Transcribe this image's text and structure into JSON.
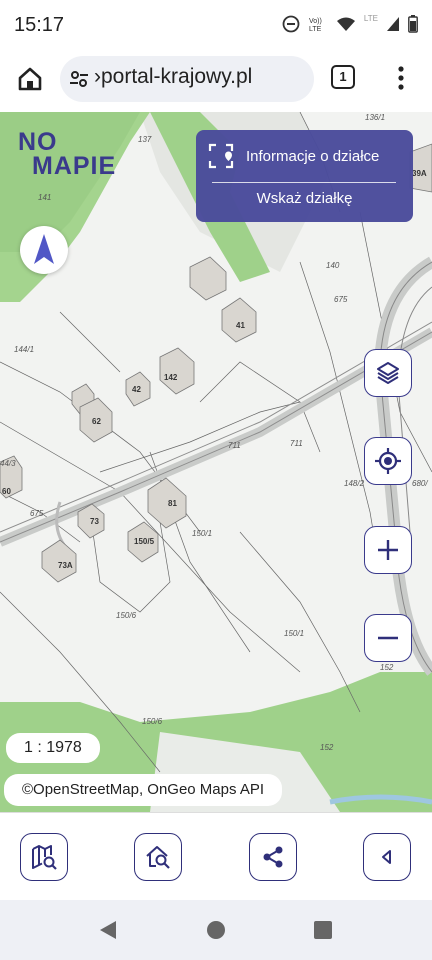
{
  "status_bar": {
    "time": "15:17",
    "icons": [
      "do-not-disturb-icon",
      "volte-icon",
      "wifi-icon",
      "lte-signal-icon",
      "battery-icon"
    ],
    "network": "LTE"
  },
  "browser": {
    "url": "›portal-krajowy.pl",
    "tab_count": "1"
  },
  "map": {
    "logo_line1": "NO",
    "logo_line2": "MAPIE",
    "info_panel": {
      "parcel_info_label": "Informacje o działce",
      "select_parcel_label": "Wskaż działkę"
    },
    "scale": "1 : 1978",
    "attribution": "©OpenStreetMap, OnGeo Maps API",
    "parcel_labels": [
      "137",
      "136/1",
      "141",
      "140",
      "675",
      "144/1",
      "142",
      "42",
      "41",
      "62",
      "711",
      "711",
      "148/2",
      "680/",
      "44/3",
      "60",
      "675",
      "73",
      "73A",
      "81",
      "150/5",
      "150/1",
      "150/6",
      "150/1",
      "152",
      "150/6",
      "152",
      "39A"
    ],
    "colors": {
      "accent": "#3a3a8c",
      "forest": "#9fd18a",
      "panel": "#4b4c9c"
    }
  },
  "controls": [
    "layers-icon",
    "locate-icon",
    "zoom-in-icon",
    "zoom-out-icon"
  ],
  "toolbar": [
    "map-search-icon",
    "home-search-icon",
    "share-icon",
    "collapse-icon"
  ],
  "nav": [
    "back-icon",
    "home-icon",
    "recents-icon"
  ]
}
